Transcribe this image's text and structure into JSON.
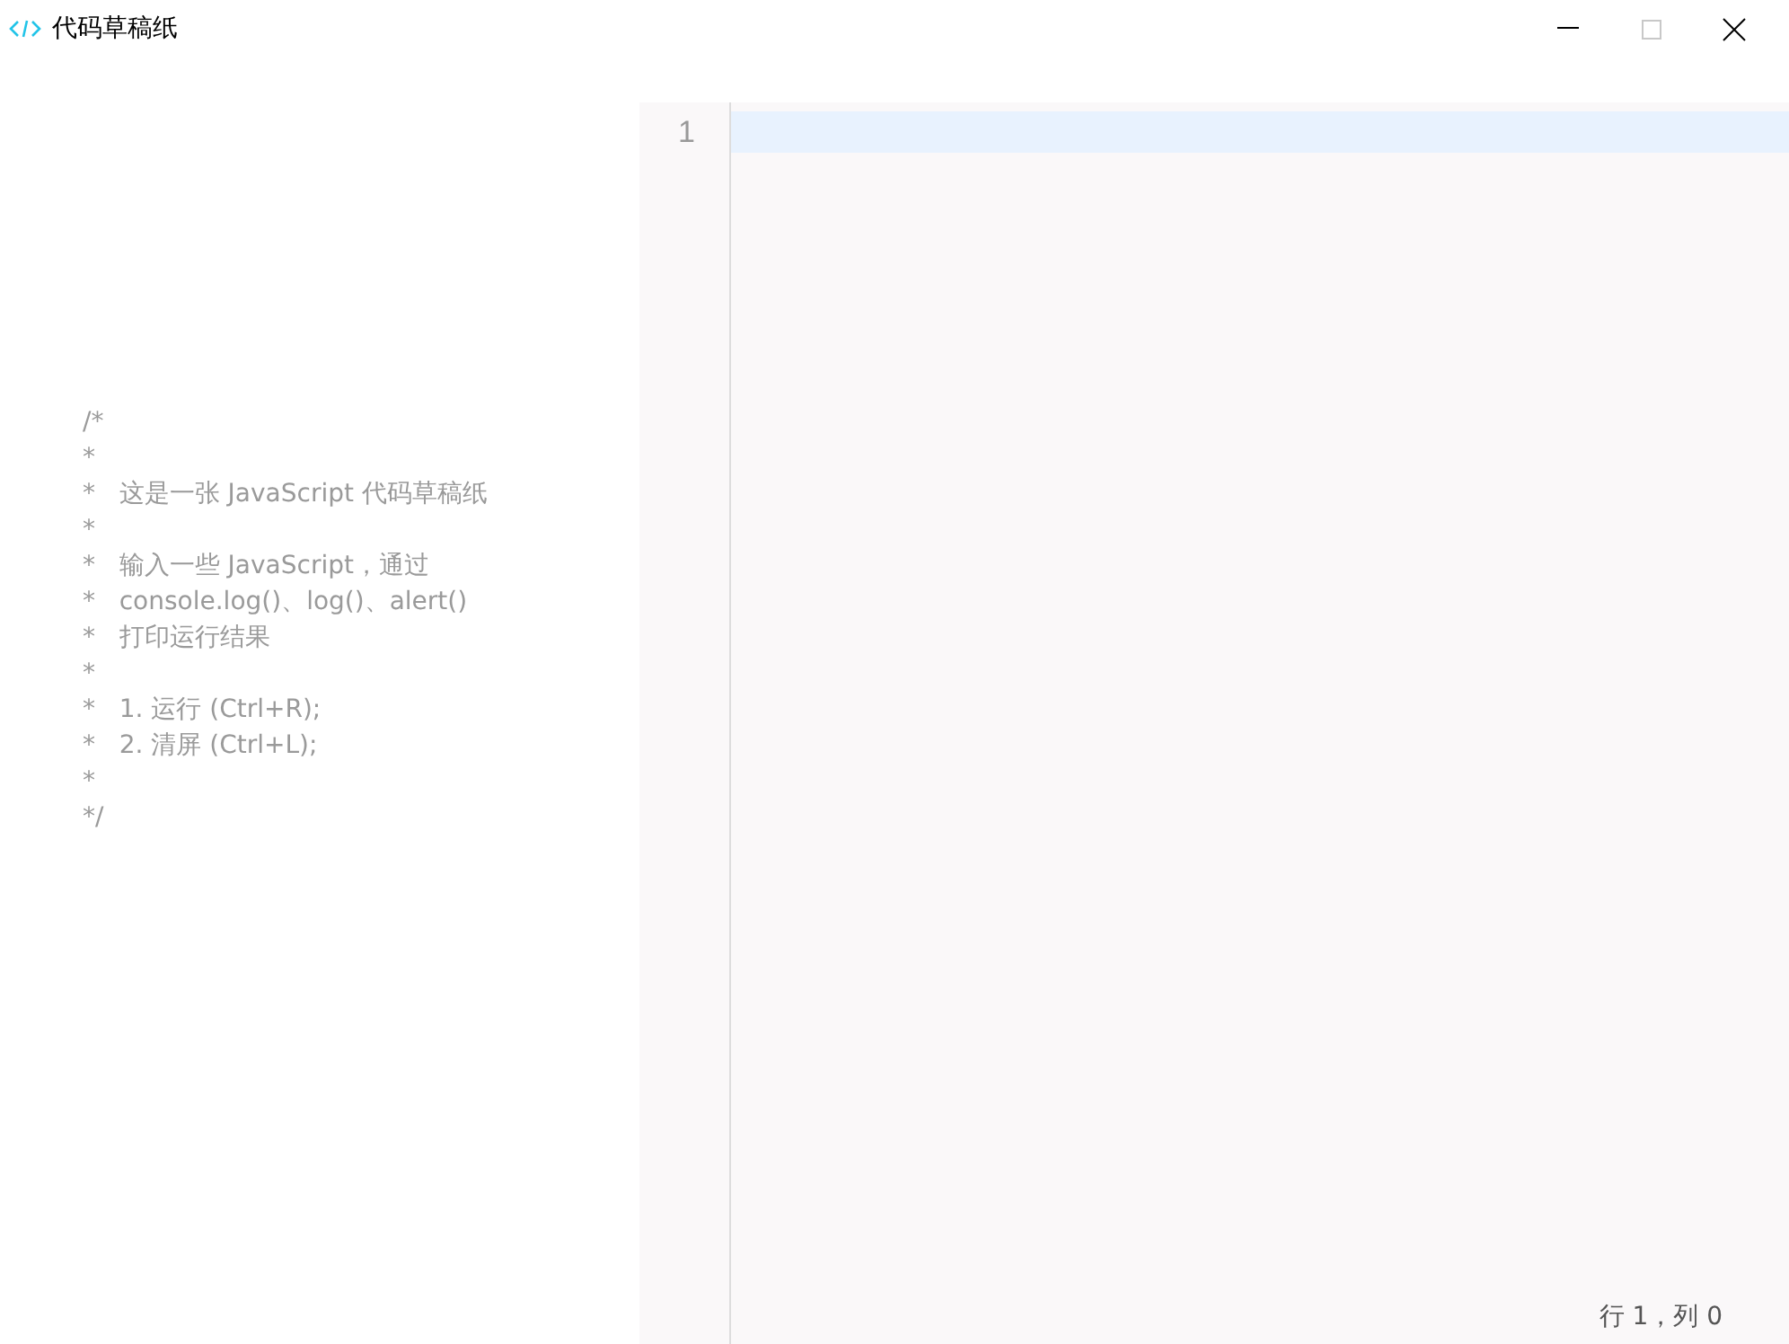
{
  "window": {
    "title": "代码草稿纸",
    "controls": [
      {
        "kind": "minimize",
        "disabled": false
      },
      {
        "kind": "maximize",
        "disabled": true
      },
      {
        "kind": "close",
        "disabled": false
      }
    ]
  },
  "hint_comment": [
    "/*",
    "*",
    "*   这是一张 JavaScript 代码草稿纸",
    "*",
    "*   输入一些 JavaScript，通过",
    "*   console.log()、log()、alert()",
    "*   打印运行结果",
    "*",
    "*   1. 运行 (Ctrl+R);",
    "*   2. 清屏 (Ctrl+L);",
    "*",
    "*/"
  ],
  "editor": {
    "lines": [
      {
        "number": "1",
        "selected": true
      }
    ]
  },
  "status_bar": {
    "cursor_position": "行 1，列 0"
  }
}
